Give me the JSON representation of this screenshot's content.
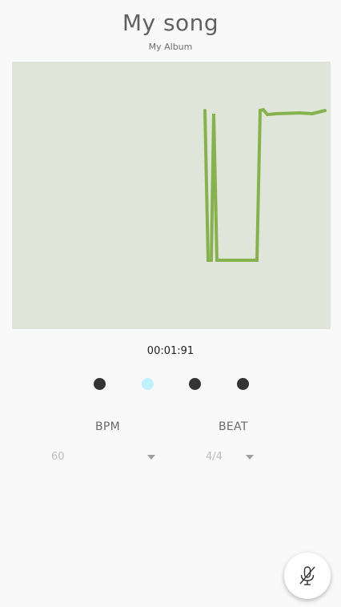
{
  "song": {
    "title": "My song",
    "album": "My Album"
  },
  "waveform": {
    "background_color": "#dfe5d9",
    "line_color": "#86b14e"
  },
  "playback": {
    "time": "00:01:91"
  },
  "beat_indicator": {
    "count": 4,
    "active_index": 1,
    "dot_color": "#333333",
    "active_color": "#bdf1fb"
  },
  "settings": {
    "bpm_label": "BPM",
    "bpm_value": "60",
    "beat_label": "BEAT",
    "beat_value": "4/4"
  },
  "fab": {
    "icon": "microphone-off-icon"
  }
}
